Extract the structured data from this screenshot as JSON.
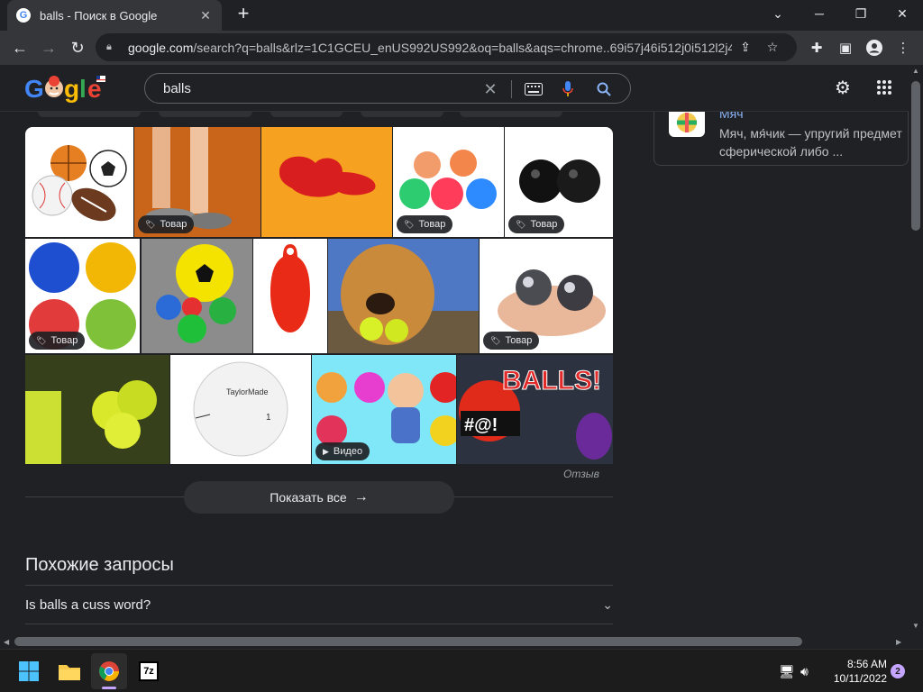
{
  "browser": {
    "tab_title": "balls - Поиск в Google",
    "favicon_letter": "G",
    "url_host": "google.com",
    "url_rest": "/search?q=balls&rlz=1C1GCEU_enUS992US992&oq=balls&aqs=chrome..69i57j46i512j0i512l2j4..."
  },
  "header": {
    "logo_text": "Google",
    "query": "balls"
  },
  "images": {
    "product_badge": "Товар",
    "video_badge": "Видео"
  },
  "results": {
    "feedback": "Отзыв",
    "show_all": "Показать все",
    "related_title": "Похожие запросы",
    "related_items": [
      "Is balls a cuss word?"
    ]
  },
  "knowledge_panel": {
    "name": "Мяч",
    "description": "Мяч, мя́чик — упругий предмет сферической либо ..."
  },
  "taskbar": {
    "time": "8:56 AM",
    "date": "10/11/2022",
    "notifications": "2",
    "app_7z": "7z"
  },
  "colors": {
    "background": "#202124",
    "toolbar": "#35363a",
    "link": "#8ab4f8",
    "mic": "#8ab4f8"
  }
}
